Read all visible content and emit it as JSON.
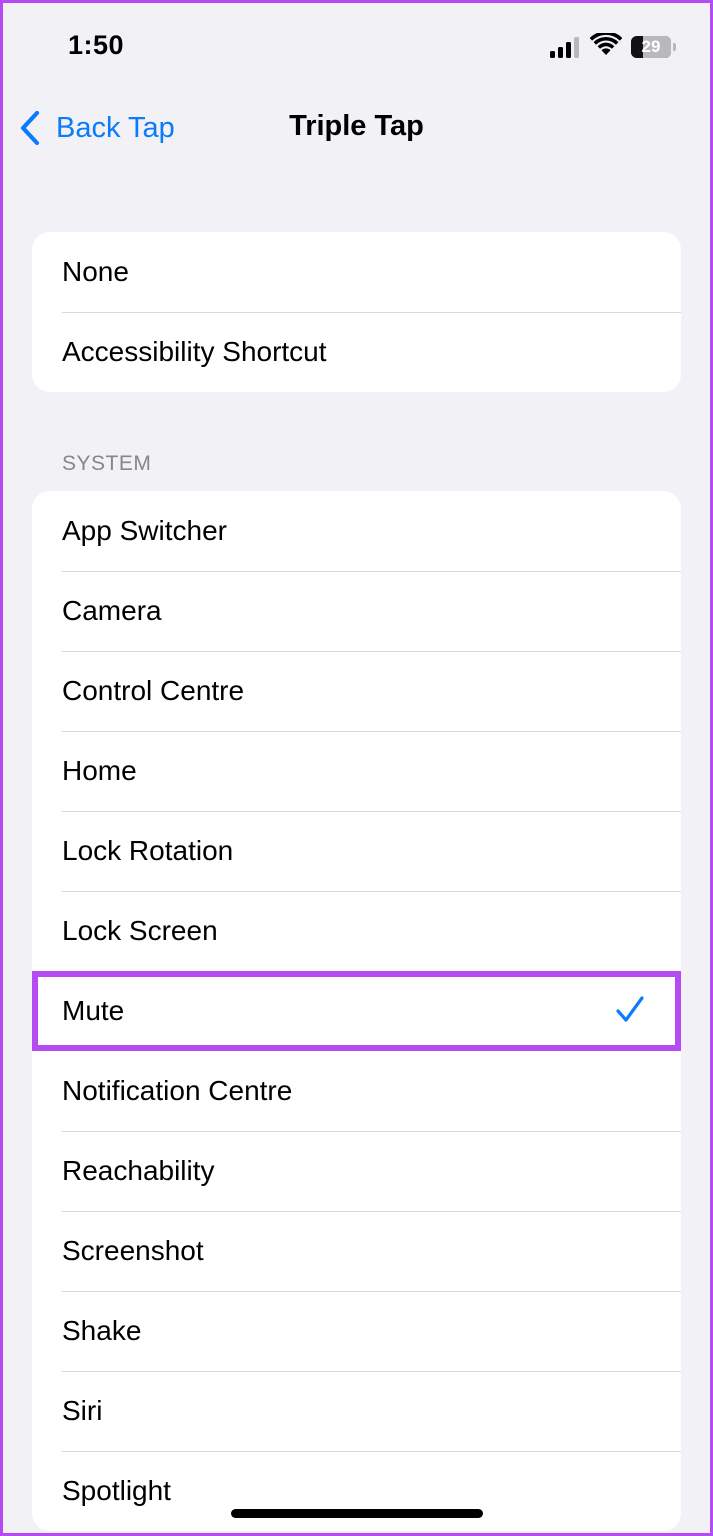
{
  "status_bar": {
    "time": "1:50",
    "battery_level": "29",
    "icons": [
      "signal-icon",
      "wifi-icon",
      "battery-icon"
    ]
  },
  "nav": {
    "back_label": "Back Tap",
    "title": "Triple Tap",
    "accent_color": "#0a7bfa"
  },
  "top_group": {
    "items": [
      {
        "label": "None"
      },
      {
        "label": "Accessibility Shortcut"
      }
    ]
  },
  "system_section": {
    "header": "SYSTEM",
    "items": [
      {
        "label": "App Switcher"
      },
      {
        "label": "Camera"
      },
      {
        "label": "Control Centre"
      },
      {
        "label": "Home"
      },
      {
        "label": "Lock Rotation"
      },
      {
        "label": "Lock Screen"
      },
      {
        "label": "Mute",
        "selected": true
      },
      {
        "label": "Notification Centre"
      },
      {
        "label": "Reachability"
      },
      {
        "label": "Screenshot"
      },
      {
        "label": "Shake"
      },
      {
        "label": "Siri"
      },
      {
        "label": "Spotlight"
      }
    ]
  },
  "highlight_color": "#b44cf2"
}
